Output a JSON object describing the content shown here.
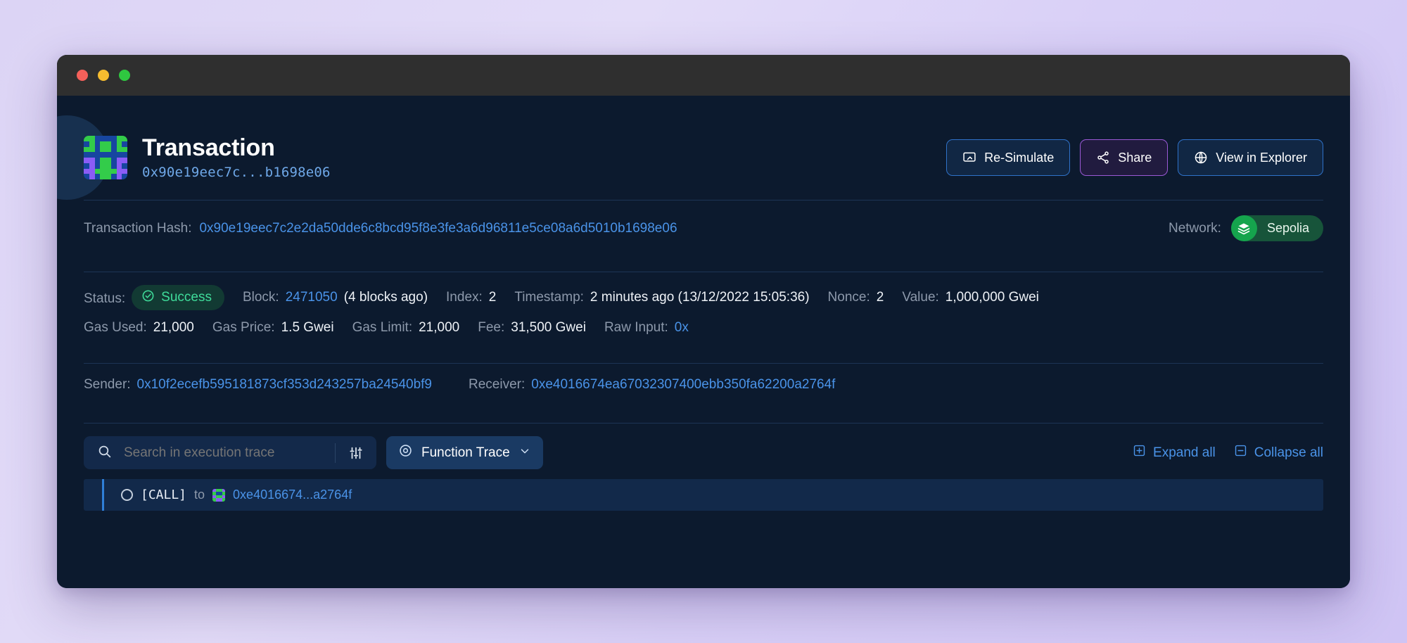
{
  "window": {
    "traffic_lights": [
      "close",
      "minimize",
      "maximize"
    ]
  },
  "header": {
    "title": "Transaction",
    "short_hash": "0x90e19eec7c...b1698e06",
    "identicon_name": "transaction-identicon",
    "actions": [
      {
        "label": "Re-Simulate",
        "icon": "monitor-icon",
        "style": "blue"
      },
      {
        "label": "Share",
        "icon": "share-icon",
        "style": "purple"
      },
      {
        "label": "View in Explorer",
        "icon": "globe-icon",
        "style": "blue"
      }
    ]
  },
  "hash_row": {
    "label": "Transaction Hash:",
    "value": "0x90e19eec7c2e2da50dde6c8bcd95f8e3fe3a6d96811e5ce08a6d5010b1698e06",
    "network_label": "Network:",
    "network_name": "Sepolia",
    "network_icon": "layers-icon"
  },
  "details": {
    "row1": [
      {
        "label": "Status:",
        "value": "Success",
        "type": "status"
      },
      {
        "label": "Block:",
        "value": "2471050",
        "type": "link"
      },
      {
        "label": "",
        "value": "(4 blocks ago)",
        "type": "plain"
      },
      {
        "label": "Index:",
        "value": "2",
        "type": "plain"
      },
      {
        "label": "Timestamp:",
        "value": "2 minutes ago (13/12/2022 15:05:36)",
        "type": "plain"
      },
      {
        "label": "Nonce:",
        "value": "2",
        "type": "plain"
      },
      {
        "label": "Value:",
        "value": "1,000,000 Gwei",
        "type": "plain"
      }
    ],
    "row2": [
      {
        "label": "Gas Used:",
        "value": "21,000",
        "type": "plain"
      },
      {
        "label": "Gas Price:",
        "value": "1.5 Gwei",
        "type": "plain"
      },
      {
        "label": "Gas Limit:",
        "value": "21,000",
        "type": "plain"
      },
      {
        "label": "Fee:",
        "value": "31,500 Gwei",
        "type": "plain"
      },
      {
        "label": "Raw Input:",
        "value": "0x",
        "type": "link"
      }
    ],
    "addresses": [
      {
        "label": "Sender:",
        "value": "0x10f2ecefb595181873cf353d243257ba24540bf9"
      },
      {
        "label": "Receiver:",
        "value": "0xe4016674ea67032307400ebb350fa62200a2764f"
      }
    ]
  },
  "trace": {
    "search_placeholder": "Search in execution trace",
    "search_value": "",
    "filter_icon": "sliders-icon",
    "search_icon": "search-icon",
    "selector_label": "Function Trace",
    "selector_icon": "target-icon",
    "selector_chevron": "chevron-down-icon",
    "expand_all_label": "Expand all",
    "collapse_all_label": "Collapse all",
    "expand_icon": "plus-square-icon",
    "collapse_icon": "minus-square-icon",
    "rows": [
      {
        "toggle_icon": "circle-icon",
        "call_type": "[CALL]",
        "connector": "to",
        "identicon_name": "receiver-identicon",
        "address": "0xe4016674...a2764f"
      }
    ]
  },
  "colors": {
    "accent_blue": "#4a93e8",
    "success_green": "#3fdc9a",
    "network_green": "#15a44d",
    "share_purple": "#9b59d6",
    "panel_bg": "#0c1a2e",
    "row_bg": "#12294a"
  }
}
